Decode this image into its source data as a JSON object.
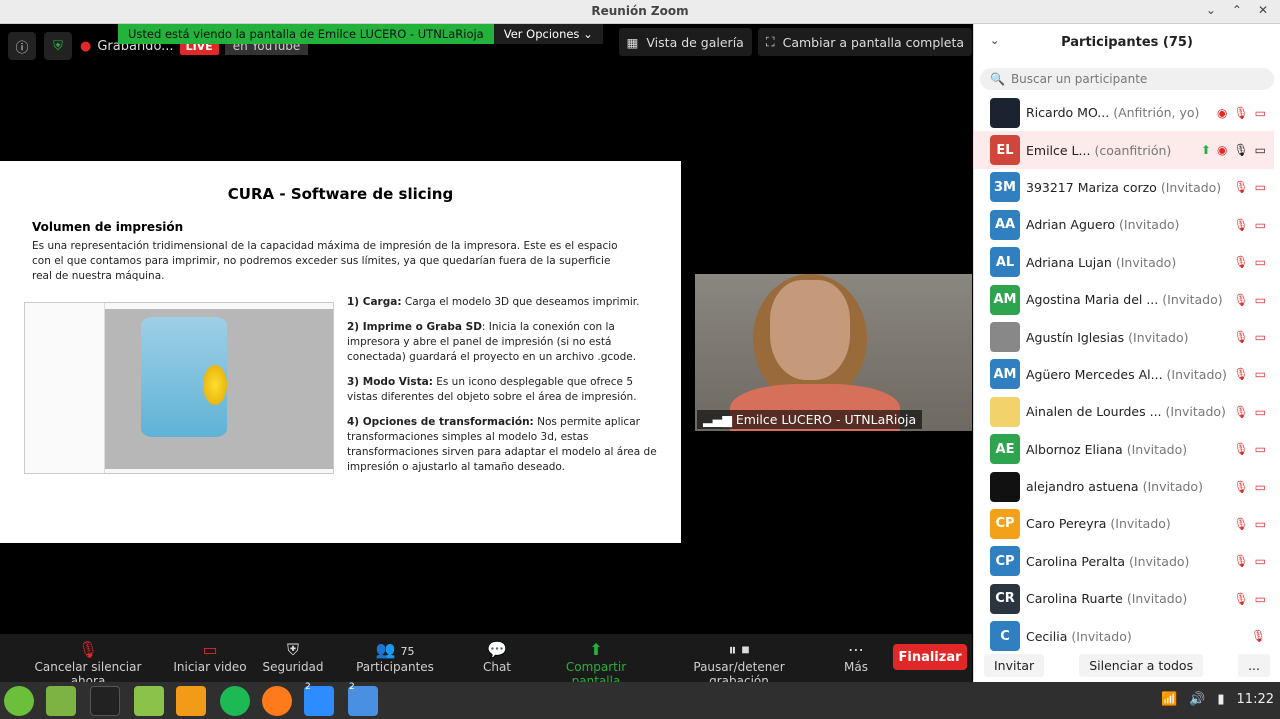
{
  "window": {
    "title": "Reunión Zoom"
  },
  "banner": {
    "text": "Usted está viendo la pantalla de Emilce LUCERO - UTNLaRioja",
    "options": "Ver Opciones"
  },
  "status": {
    "recording": "Grabando...",
    "live": "LIVE",
    "youtube": "en YouTube"
  },
  "top_buttons": {
    "gallery": "Vista de galería",
    "fullscreen": "Cambiar a pantalla completa"
  },
  "slide": {
    "title": "CURA   -   Software de slicing",
    "subtitle": "Volumen de impresión",
    "intro": "Es una representación tridimensional de la capacidad máxima de impresión de la impresora. Este es el espacio con el que contamos para imprimir, no podremos exceder sus límites, ya que quedarían fuera de la superficie real de nuestra máquina.",
    "steps": [
      {
        "head": "1) Carga:",
        "text": " Carga el modelo 3D que deseamos imprimir."
      },
      {
        "head": "2) Imprime o Graba SD",
        "text": ": Inicia la conexión con la impresora y abre el panel de impresión (si no está conectada) guardará el proyecto en un archivo .gcode."
      },
      {
        "head": "3) Modo Vista:",
        "text": " Es un icono desplegable que ofrece 5 vistas diferentes del objeto sobre el área de impresión."
      },
      {
        "head": "4) Opciones de transformación:",
        "text": " Nos permite aplicar transformaciones simples al modelo 3d, estas transformaciones sirven para adaptar el modelo al área de impresión o ajustarlo al tamaño deseado."
      }
    ]
  },
  "self_video": {
    "name": "Emilce LUCERO - UTNLaRioja"
  },
  "toolbar": {
    "mute": "Cancelar silenciar ahora",
    "video": "Iniciar video",
    "security": "Seguridad",
    "participants": "Participantes",
    "participants_count": "75",
    "chat": "Chat",
    "share": "Compartir pantalla",
    "pause_record": "Pausar/detener grabación",
    "more": "Más",
    "end": "Finalizar"
  },
  "panel": {
    "title": "Participantes (75)",
    "search_placeholder": "Buscar un participante",
    "participants": [
      {
        "initials": "",
        "color": "#1b2230",
        "name": "Ricardo MO...",
        "role": "(Anfitrión, yo)"
      },
      {
        "initials": "EL",
        "color": "#d0463b",
        "name": "Emilce L...",
        "role": "(coanfitrión)"
      },
      {
        "initials": "3M",
        "color": "#2f7fc1",
        "name": "393217 Mariza corzo",
        "role": "(Invitado)"
      },
      {
        "initials": "AA",
        "color": "#2f7fc1",
        "name": "Adrian Aguero",
        "role": "(Invitado)"
      },
      {
        "initials": "AL",
        "color": "#2f7fc1",
        "name": "Adriana Lujan",
        "role": "(Invitado)"
      },
      {
        "initials": "AM",
        "color": "#2ea44f",
        "name": "Agostina Maria del ...",
        "role": "(Invitado)"
      },
      {
        "initials": "",
        "color": "#888888",
        "name": "Agustín Iglesias",
        "role": "(Invitado)"
      },
      {
        "initials": "AM",
        "color": "#2f7fc1",
        "name": "Agüero Mercedes Al...",
        "role": "(Invitado)"
      },
      {
        "initials": "",
        "color": "#f2d36b",
        "name": "Ainalen de Lourdes ...",
        "role": "(Invitado)"
      },
      {
        "initials": "AE",
        "color": "#2ea44f",
        "name": "Albornoz Eliana",
        "role": "(Invitado)"
      },
      {
        "initials": "",
        "color": "#111111",
        "name": "alejandro astuena",
        "role": "(Invitado)"
      },
      {
        "initials": "CP",
        "color": "#f2a118",
        "name": "Caro Pereyra",
        "role": "(Invitado)"
      },
      {
        "initials": "CP",
        "color": "#2f7fc1",
        "name": "Carolina Peralta",
        "role": "(Invitado)"
      },
      {
        "initials": "CR",
        "color": "#2b3540",
        "name": "Carolina Ruarte",
        "role": "(Invitado)"
      },
      {
        "initials": "C",
        "color": "#2f7fc1",
        "name": "Cecilia",
        "role": "(Invitado)"
      }
    ],
    "invite": "Invitar",
    "mute_all": "Silenciar a todos",
    "more": "..."
  },
  "taskbar": {
    "time": "11:22",
    "badge": "2"
  }
}
